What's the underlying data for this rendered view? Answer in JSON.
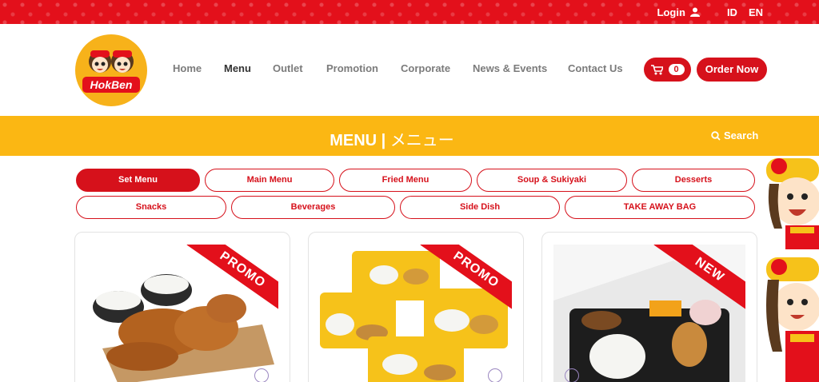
{
  "topbar": {
    "login": "Login",
    "lang_id": "ID",
    "lang_en": "EN"
  },
  "brand": {
    "logo_text": "HokBen"
  },
  "nav": [
    {
      "label": "Home",
      "active": false
    },
    {
      "label": "Menu",
      "active": true
    },
    {
      "label": "Outlet",
      "active": false
    },
    {
      "label": "Promotion",
      "active": false
    },
    {
      "label": "Corporate",
      "active": false
    },
    {
      "label": "News & Events",
      "active": false
    },
    {
      "label": "Contact Us",
      "active": false
    }
  ],
  "cart": {
    "count": "0"
  },
  "order_button": "Order Now",
  "band": {
    "title": "MENU",
    "separator": " | ",
    "title_jp": "メニュー",
    "search": "Search"
  },
  "categories_row1": [
    "Set Menu",
    "Main Menu",
    "Fried Menu",
    "Soup & Sukiyaki",
    "Desserts"
  ],
  "categories_row2": [
    "Snacks",
    "Beverages",
    "Side Dish",
    "TAKE AWAY BAG"
  ],
  "active_category": "Set Menu",
  "cards": [
    {
      "badge": "PROMO"
    },
    {
      "badge": "PROMO"
    },
    {
      "badge": "NEW"
    }
  ],
  "colors": {
    "brand_red": "#d6111b",
    "brand_yellow": "#fbb713"
  }
}
